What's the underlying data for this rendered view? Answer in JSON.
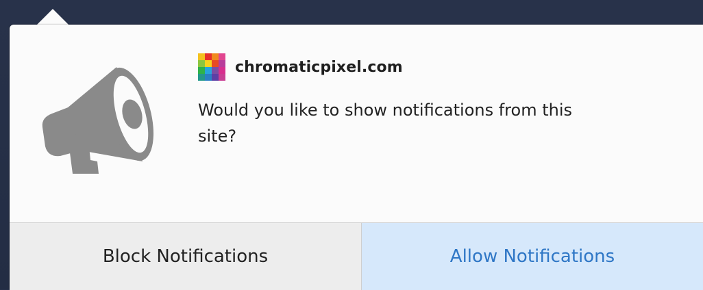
{
  "site": {
    "name": "chromaticpixel.com",
    "favicon_colors": [
      "#f4c21f",
      "#e7302b",
      "#f08a1f",
      "#e14690",
      "#8dc63f",
      "#f7d21e",
      "#e84b23",
      "#b83d9b",
      "#2fb24a",
      "#27a4dd",
      "#7a4ea3",
      "#d72f8e",
      "#23988b",
      "#2a7fc6",
      "#5d3fa5",
      "#c93e93"
    ]
  },
  "prompt": {
    "message": "Would you like to show notifications from this site?"
  },
  "buttons": {
    "block_label": "Block Notifications",
    "allow_label": "Allow Notifications"
  },
  "icons": {
    "main": "megaphone-icon"
  },
  "colors": {
    "backdrop": "#253048",
    "panel": "#fbfbfb",
    "block_bg": "#ededed",
    "allow_bg": "#d6e8fb",
    "allow_text": "#2f77c6",
    "icon": "#8a8a8a"
  }
}
